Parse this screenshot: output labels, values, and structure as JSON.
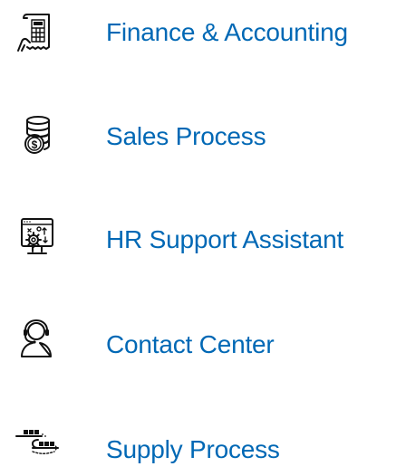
{
  "menu": {
    "items": [
      {
        "label": "Finance & Accounting",
        "icon": "receipt-calculator-icon"
      },
      {
        "label": "Sales Process",
        "icon": "coin-stack-dollar-icon"
      },
      {
        "label": "HR Support Assistant",
        "icon": "monitor-gear-icon"
      },
      {
        "label": "Contact Center",
        "icon": "headset-agent-icon"
      },
      {
        "label": "Supply Process",
        "icon": "supply-flow-icon"
      }
    ]
  },
  "colors": {
    "link": "#0068b5",
    "icon": "#111111",
    "background": "#ffffff"
  }
}
